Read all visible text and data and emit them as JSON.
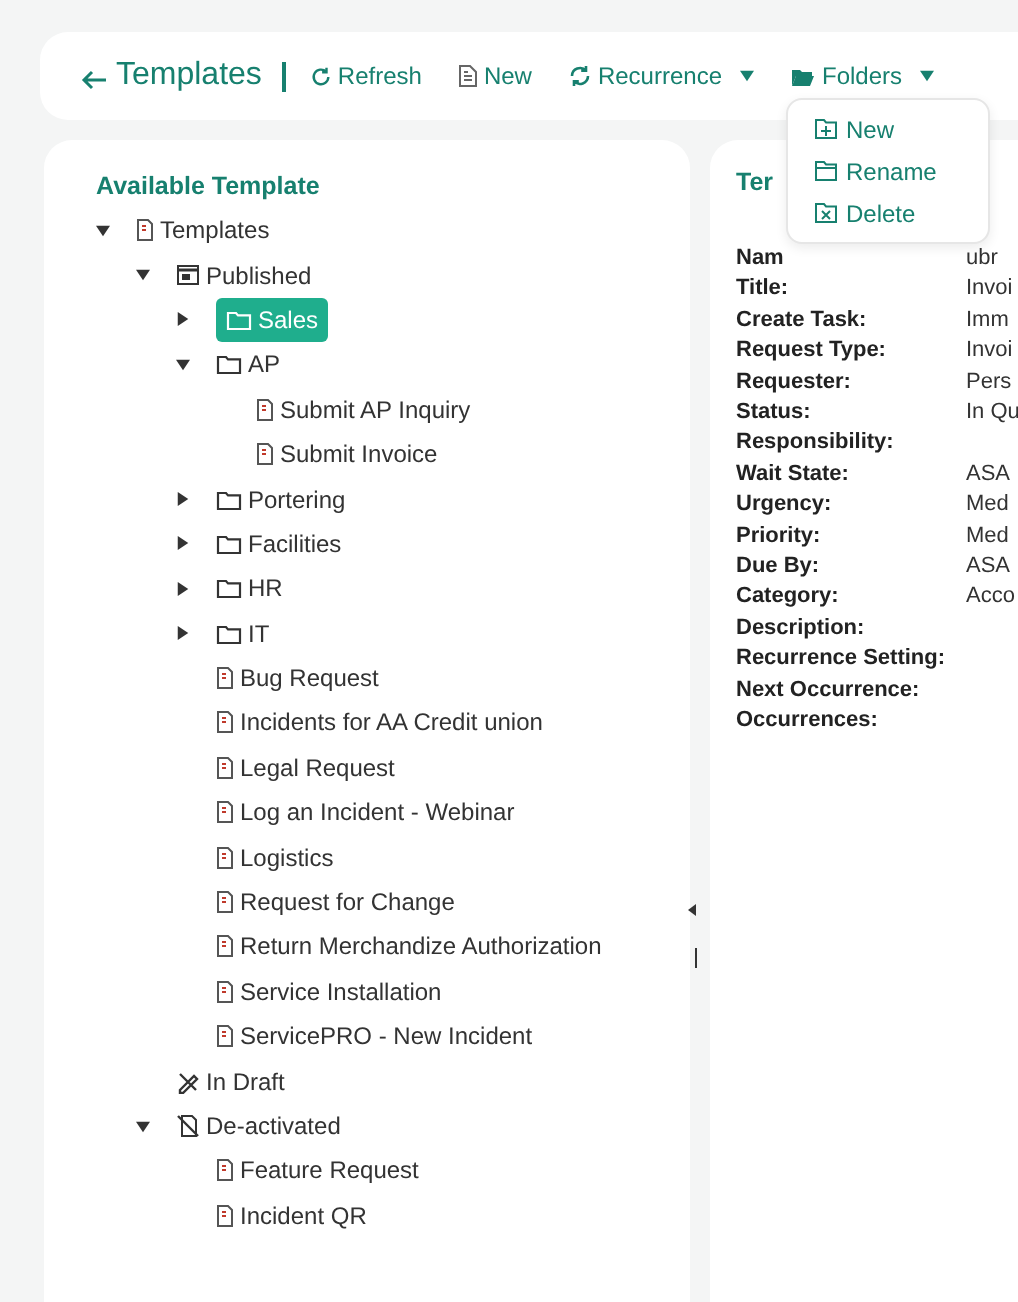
{
  "toolbar": {
    "title": "Templates",
    "buttons": [
      {
        "label": "Refresh",
        "kind": "refresh",
        "dropdown": false
      },
      {
        "label": "New",
        "kind": "new",
        "dropdown": false
      },
      {
        "label": "Recurrence",
        "kind": "recurrence",
        "dropdown": true
      },
      {
        "label": "Folders",
        "kind": "folders",
        "dropdown": true,
        "expanded": true
      }
    ]
  },
  "folders_menu": {
    "items": [
      {
        "label": "New",
        "kind": "add"
      },
      {
        "label": "Rename",
        "kind": "rename"
      },
      {
        "label": "Delete",
        "kind": "delete"
      }
    ]
  },
  "tree": {
    "title": "Available Template",
    "nodes": [
      {
        "label": "Templates",
        "kind": "root",
        "expanded": true,
        "selected": false,
        "children": [
          {
            "label": "Published",
            "kind": "published",
            "expanded": true,
            "selected": false,
            "children": [
              {
                "label": "Sales",
                "kind": "folder",
                "expanded": false,
                "selected": true
              },
              {
                "label": "AP",
                "kind": "folder",
                "expanded": true,
                "selected": false,
                "children": [
                  {
                    "label": "Submit AP Inquiry",
                    "kind": "doc",
                    "selected": false
                  },
                  {
                    "label": "Submit Invoice",
                    "kind": "doc",
                    "selected": false
                  }
                ]
              },
              {
                "label": "Portering",
                "kind": "folder",
                "expanded": false,
                "selected": false
              },
              {
                "label": "Facilities",
                "kind": "folder",
                "expanded": false,
                "selected": false
              },
              {
                "label": "HR",
                "kind": "folder",
                "expanded": false,
                "selected": false
              },
              {
                "label": "IT",
                "kind": "folder",
                "expanded": false,
                "selected": false
              },
              {
                "label": "Bug Request",
                "kind": "doc",
                "selected": false
              },
              {
                "label": "Incidents for AA Credit union",
                "kind": "doc",
                "selected": false
              },
              {
                "label": "Legal Request",
                "kind": "doc",
                "selected": false
              },
              {
                "label": "Log an Incident - Webinar",
                "kind": "doc",
                "selected": false
              },
              {
                "label": "Logistics",
                "kind": "doc",
                "selected": false
              },
              {
                "label": "Request for Change",
                "kind": "doc",
                "selected": false
              },
              {
                "label": "Return Merchandize Authorization",
                "kind": "doc",
                "selected": false
              },
              {
                "label": "Service Installation",
                "kind": "doc",
                "selected": false
              },
              {
                "label": "ServicePRO - New Incident",
                "kind": "doc",
                "selected": false
              }
            ]
          },
          {
            "label": "In Draft",
            "kind": "draft",
            "selected": false
          },
          {
            "label": "De-activated",
            "kind": "deactivated",
            "expanded": true,
            "selected": false,
            "children": [
              {
                "label": "Feature Request",
                "kind": "doc",
                "selected": false
              },
              {
                "label": "Incident QR",
                "kind": "doc",
                "selected": false
              }
            ]
          }
        ]
      }
    ]
  },
  "details": {
    "title": "Ter",
    "fields": [
      {
        "label": "Nam",
        "value": "ubr"
      },
      {
        "label": "Title:",
        "value": "Invoi"
      },
      {
        "label": "Create Task:",
        "value": "Imm"
      },
      {
        "label": "Request Type:",
        "value": "Invoi"
      },
      {
        "label": "Requester:",
        "value": "Pers"
      },
      {
        "label": "Status:",
        "value": "In Qu"
      },
      {
        "label": "Responsibility:"
      },
      {
        "label": "Wait State:",
        "value": "ASA"
      },
      {
        "label": "Urgency:",
        "value": "Med"
      },
      {
        "label": "Priority:",
        "value": "Med"
      },
      {
        "label": "Due By:",
        "value": "ASA"
      },
      {
        "label": "Category:",
        "value": "Acco"
      },
      {
        "label": "Description:"
      },
      {
        "label": "Recurrence Setting:"
      },
      {
        "label": "Next Occurrence:"
      },
      {
        "label": "Occurrences:"
      }
    ]
  }
}
